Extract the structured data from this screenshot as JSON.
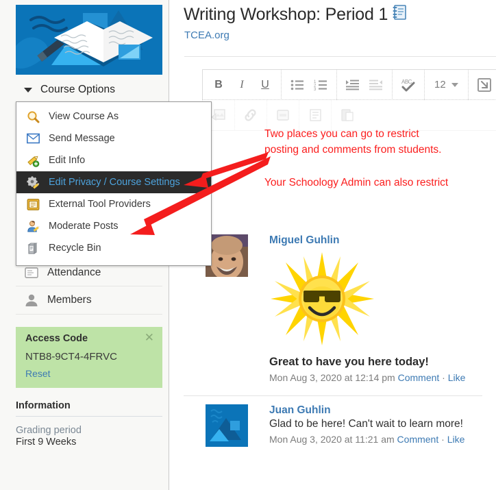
{
  "sidebar": {
    "course_banner_alt": "writing-workshop-course-banner",
    "course_options_label": "Course Options",
    "nav_items": [
      {
        "label": "Attendance",
        "icon": "attendance-icon"
      },
      {
        "label": "Members",
        "icon": "members-icon"
      }
    ],
    "access_code": {
      "title": "Access Code",
      "code": "NTB8-9CT4-4FRVC",
      "reset_label": "Reset",
      "close_icon": "close-icon"
    },
    "information": {
      "title": "Information",
      "grading_period_label": "Grading period",
      "grading_period_value": "First 9 Weeks"
    }
  },
  "menu": {
    "items": [
      {
        "label": "View Course As",
        "icon": "magnifier-icon",
        "selected": false
      },
      {
        "label": "Send Message",
        "icon": "envelope-icon",
        "selected": false
      },
      {
        "label": "Edit Info",
        "icon": "pencil-add-icon",
        "selected": false
      },
      {
        "label": "Edit Privacy / Course Settings",
        "icon": "gear-pencil-icon",
        "selected": true
      },
      {
        "label": "External Tool Providers",
        "icon": "external-tool-icon",
        "selected": false
      },
      {
        "label": "Moderate Posts",
        "icon": "person-pencil-icon",
        "selected": false
      },
      {
        "label": "Recycle Bin",
        "icon": "recycle-bin-icon",
        "selected": false
      }
    ]
  },
  "header": {
    "title": "Writing Workshop: Period 1",
    "title_icon": "notebook-icon",
    "subtitle": "TCEA.org"
  },
  "toolbar": {
    "bold_label": "B",
    "italic_label": "I",
    "underline_label": "U",
    "bullet_list_icon": "bullet-list-icon",
    "numbered_list_icon": "numbered-list-icon",
    "indent_icon": "indent-increase-icon",
    "outdent_icon": "indent-decrease-icon",
    "spellcheck_label": "ABC",
    "spellcheck_icon": "spellcheck-icon",
    "font_size_value": "12",
    "insert_icon": "insert-icon",
    "row2_icons": [
      "image-insert-icon",
      "link-icon",
      "file-insert-icon",
      "document-icon",
      "paste-icon"
    ]
  },
  "posts": [
    {
      "author": "Miguel Guhlin",
      "avatar": "miguel-avatar",
      "attachment_icon": "sun-sunglasses-emoji",
      "text": "Great to have you here today!",
      "timestamp": "Mon Aug 3, 2020 at 12:14 pm",
      "comment_label": "Comment",
      "separator": "·",
      "like_label": "Like"
    },
    {
      "author": "Juan Guhlin",
      "avatar": "juan-avatar",
      "text": "Glad to be here! Can't wait to learn more!",
      "timestamp": "Mon Aug 3, 2020 at 11:21 am",
      "comment_label": "Comment",
      "separator": "·",
      "like_label": "Like"
    }
  ],
  "annotations": {
    "note1_line1": "Two places you can go to restrict",
    "note1_line2": "posting and comments from students.",
    "note2_line1": "Your Schoology Admin can also restrict",
    "color": "#fb1e1e"
  },
  "colors": {
    "accent_blue": "#3d7ab3",
    "banner_blue": "#0b74b8",
    "access_green": "#bee3a7",
    "menu_highlight": "#2b2b2b",
    "menu_highlight_text": "#4da3dd",
    "annotation_red": "#fb1e1e"
  }
}
